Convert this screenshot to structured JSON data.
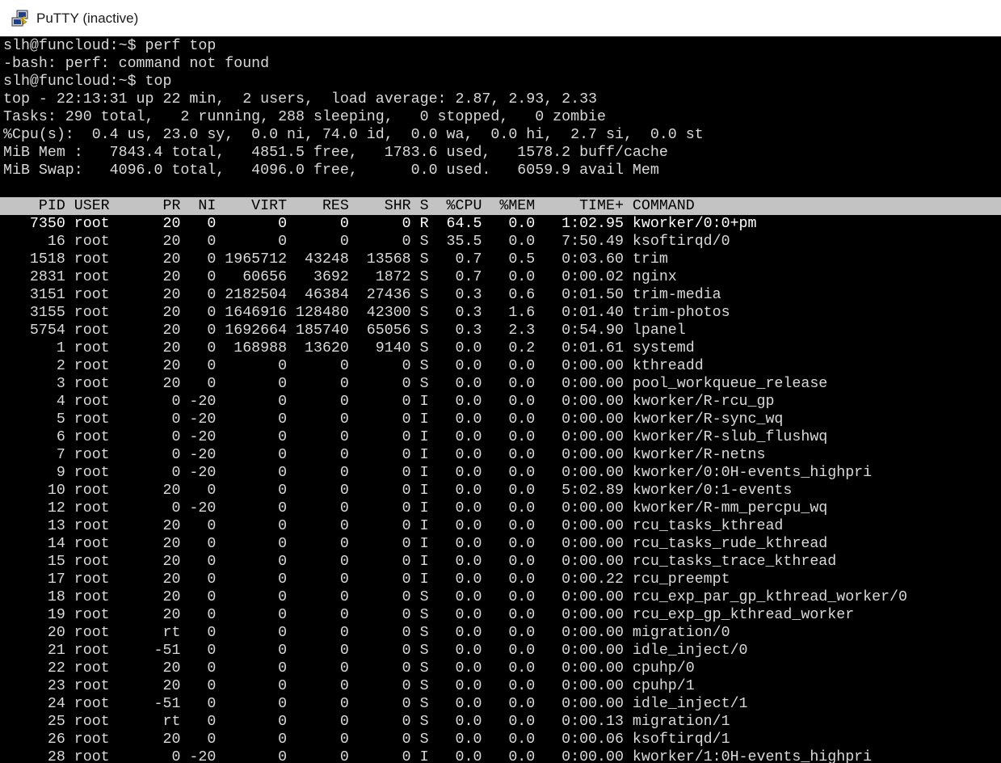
{
  "window": {
    "title": "PuTTY (inactive)",
    "icon": "putty-icon"
  },
  "terminal": {
    "lines": [
      "slh@funcloud:~$ perf top",
      "-bash: perf: command not found",
      "slh@funcloud:~$ top",
      "top - 22:13:31 up 22 min,  2 users,  load average: 2.87, 2.93, 2.33",
      "Tasks: 290 total,   2 running, 288 sleeping,   0 stopped,   0 zombie",
      "%Cpu(s):  0.4 us, 23.0 sy,  0.0 ni, 74.0 id,  0.0 wa,  0.0 hi,  2.7 si,  0.0 st",
      "MiB Mem :   7843.4 total,   4851.5 free,   1783.6 used,   1578.2 buff/cache",
      "MiB Swap:   4096.0 total,   4096.0 free,      0.0 used.   6059.9 avail Mem",
      ""
    ],
    "process_header": "    PID USER      PR  NI    VIRT    RES    SHR S  %CPU  %MEM     TIME+ COMMAND",
    "processes": [
      "   7350 root      20   0       0      0      0 R  64.5   0.0   1:02.95 kworker/0:0+pm",
      "     16 root      20   0       0      0      0 S  35.5   0.0   7:50.49 ksoftirqd/0",
      "   1518 root      20   0 1965712  43248  13568 S   0.7   0.5   0:03.60 trim",
      "   2831 root      20   0   60656   3692   1872 S   0.7   0.0   0:00.02 nginx",
      "   3151 root      20   0 2182504  46384  27436 S   0.3   0.6   0:01.50 trim-media",
      "   3155 root      20   0 1646916 128480  42300 S   0.3   1.6   0:01.40 trim-photos",
      "   5754 root      20   0 1692664 185740  65056 S   0.3   2.3   0:54.90 lpanel",
      "      1 root      20   0  168988  13620   9140 S   0.0   0.2   0:01.61 systemd",
      "      2 root      20   0       0      0      0 S   0.0   0.0   0:00.00 kthreadd",
      "      3 root      20   0       0      0      0 S   0.0   0.0   0:00.00 pool_workqueue_release",
      "      4 root       0 -20       0      0      0 I   0.0   0.0   0:00.00 kworker/R-rcu_gp",
      "      5 root       0 -20       0      0      0 I   0.0   0.0   0:00.00 kworker/R-sync_wq",
      "      6 root       0 -20       0      0      0 I   0.0   0.0   0:00.00 kworker/R-slub_flushwq",
      "      7 root       0 -20       0      0      0 I   0.0   0.0   0:00.00 kworker/R-netns",
      "      9 root       0 -20       0      0      0 I   0.0   0.0   0:00.00 kworker/0:0H-events_highpri",
      "     10 root      20   0       0      0      0 I   0.0   0.0   5:02.89 kworker/0:1-events",
      "     12 root       0 -20       0      0      0 I   0.0   0.0   0:00.00 kworker/R-mm_percpu_wq",
      "     13 root      20   0       0      0      0 I   0.0   0.0   0:00.00 rcu_tasks_kthread",
      "     14 root      20   0       0      0      0 I   0.0   0.0   0:00.00 rcu_tasks_rude_kthread",
      "     15 root      20   0       0      0      0 I   0.0   0.0   0:00.00 rcu_tasks_trace_kthread",
      "     17 root      20   0       0      0      0 I   0.0   0.0   0:00.22 rcu_preempt",
      "     18 root      20   0       0      0      0 S   0.0   0.0   0:00.00 rcu_exp_par_gp_kthread_worker/0",
      "     19 root      20   0       0      0      0 S   0.0   0.0   0:00.00 rcu_exp_gp_kthread_worker",
      "     20 root      rt   0       0      0      0 S   0.0   0.0   0:00.00 migration/0",
      "     21 root     -51   0       0      0      0 S   0.0   0.0   0:00.00 idle_inject/0",
      "     22 root      20   0       0      0      0 S   0.0   0.0   0:00.00 cpuhp/0",
      "     23 root      20   0       0      0      0 S   0.0   0.0   0:00.00 cpuhp/1",
      "     24 root     -51   0       0      0      0 S   0.0   0.0   0:00.00 idle_inject/1",
      "     25 root      rt   0       0      0      0 S   0.0   0.0   0:00.13 migration/1",
      "     26 root      20   0       0      0      0 S   0.0   0.0   0:00.06 ksoftirqd/1",
      "     28 root       0 -20       0      0      0 I   0.0   0.0   0:00.00 kworker/1:0H-events_highpri"
    ]
  }
}
